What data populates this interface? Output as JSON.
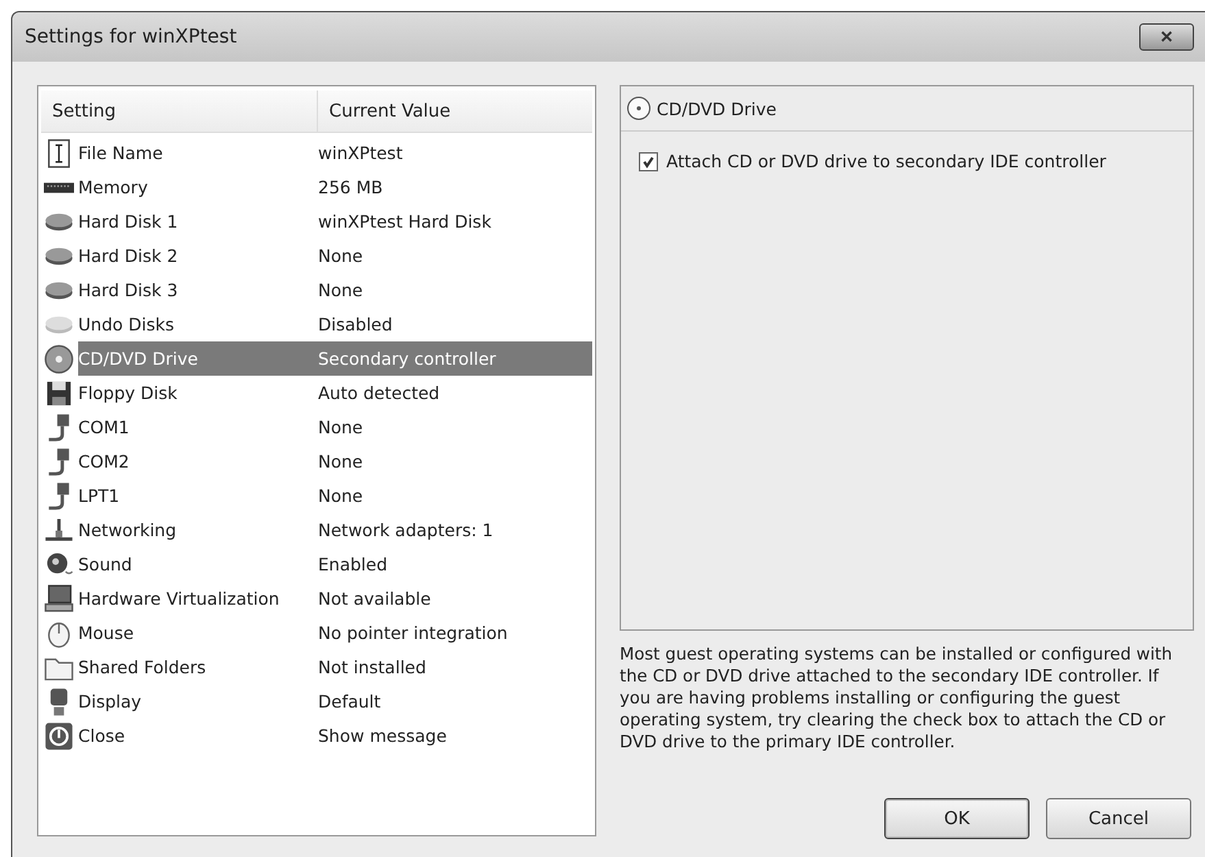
{
  "window": {
    "title": "Settings for winXPtest",
    "close": "✕"
  },
  "table": {
    "columns": [
      "Setting",
      "Current Value"
    ],
    "rows": [
      {
        "kind": "file",
        "setting": "File Name",
        "value": "winXPtest",
        "selected": false
      },
      {
        "kind": "memory",
        "setting": "Memory",
        "value": "256 MB",
        "selected": false
      },
      {
        "kind": "disk",
        "setting": "Hard Disk 1",
        "value": "winXPtest Hard Disk",
        "selected": false
      },
      {
        "kind": "disk",
        "setting": "Hard Disk 2",
        "value": "None",
        "selected": false
      },
      {
        "kind": "disk",
        "setting": "Hard Disk 3",
        "value": "None",
        "selected": false
      },
      {
        "kind": "undo",
        "setting": "Undo Disks",
        "value": "Disabled",
        "selected": false
      },
      {
        "kind": "cd",
        "setting": "CD/DVD Drive",
        "value": "Secondary controller",
        "selected": true
      },
      {
        "kind": "floppy",
        "setting": "Floppy Disk",
        "value": "Auto detected",
        "selected": false
      },
      {
        "kind": "port",
        "setting": "COM1",
        "value": "None",
        "selected": false
      },
      {
        "kind": "port",
        "setting": "COM2",
        "value": "None",
        "selected": false
      },
      {
        "kind": "port",
        "setting": "LPT1",
        "value": "None",
        "selected": false
      },
      {
        "kind": "network",
        "setting": "Networking",
        "value": "Network adapters: 1",
        "selected": false
      },
      {
        "kind": "sound",
        "setting": "Sound",
        "value": "Enabled",
        "selected": false
      },
      {
        "kind": "hardware",
        "setting": "Hardware Virtualization",
        "value": "Not available",
        "selected": false
      },
      {
        "kind": "mouse",
        "setting": "Mouse",
        "value": "No pointer integration",
        "selected": false
      },
      {
        "kind": "folder",
        "setting": "Shared Folders",
        "value": "Not installed",
        "selected": false
      },
      {
        "kind": "display",
        "setting": "Display",
        "value": "Default",
        "selected": false
      },
      {
        "kind": "close",
        "setting": "Close",
        "value": "Show message",
        "selected": false
      }
    ]
  },
  "detail": {
    "title": "CD/DVD Drive",
    "checkbox": {
      "label": "Attach CD or DVD drive to secondary IDE controller",
      "checked": true
    },
    "description": "Most guest operating systems can be installed or configured with the CD or DVD drive attached to the secondary IDE controller. If you are having problems installing or configuring the guest operating system, try clearing the check box to attach the CD or DVD drive to the primary IDE controller."
  },
  "buttons": [
    "OK",
    "Cancel"
  ]
}
